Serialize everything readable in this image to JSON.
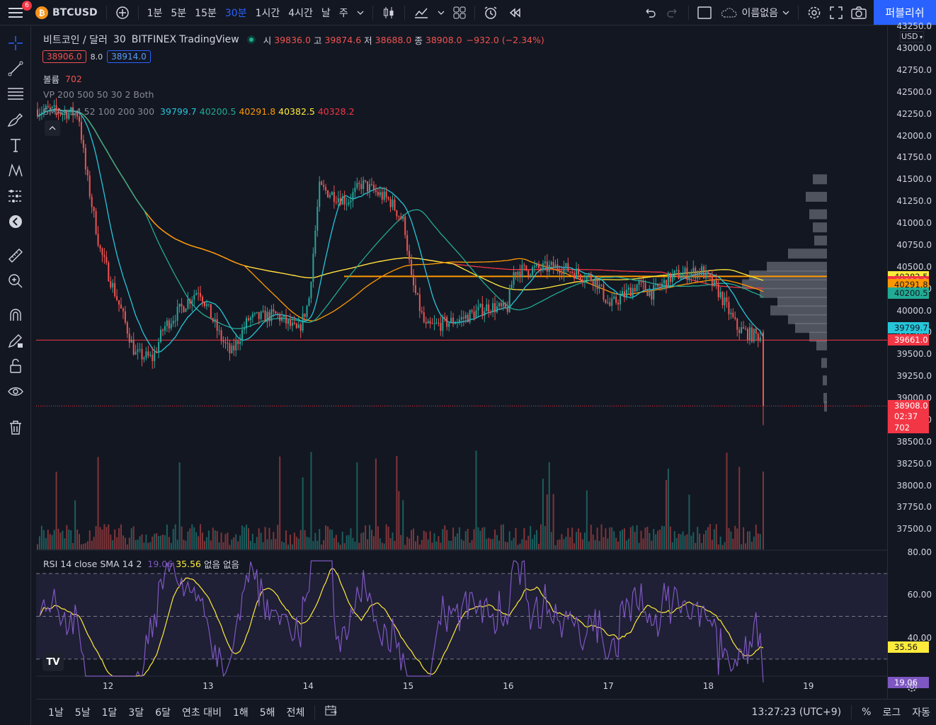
{
  "topbar": {
    "menu_badge": "6",
    "symbol": "BTCUSD",
    "intervals": [
      "1분",
      "5분",
      "15분",
      "30분",
      "1시간",
      "4시간",
      "날",
      "주"
    ],
    "active_interval": "30분",
    "layout_name": "이름없음",
    "publish": "퍼블리쉬"
  },
  "legend": {
    "title": "비트코인 / 달러",
    "interval": "30",
    "exchange": "BITFINEX",
    "source": "TradingView",
    "o_label": "시",
    "o": "39836.0",
    "h_label": "고",
    "h": "39874.6",
    "l_label": "저",
    "l": "38688.0",
    "c_label": "종",
    "c": "38908.0",
    "change": "−932.0 (−2.34%)",
    "bid": "38906.0",
    "spread": "8.0",
    "ask": "38914.0",
    "volume_label": "볼륨",
    "volume": "702",
    "vp_label": "VP 200 500 50 30 2 Both",
    "sma_label": "SMAs 14 52 100 200 300",
    "sma_values": [
      "39799.7",
      "40200.5",
      "40291.8",
      "40382.5",
      "40328.2"
    ],
    "rsi_label": "RSI 14 close SMA 14 2",
    "rsi_value": "19.06",
    "rsi_sma": "35.56",
    "rsi_none1": "없음",
    "rsi_none2": "없음"
  },
  "price_scale": {
    "currency": "USD",
    "ticks": [
      "43250.0",
      "43000.0",
      "42750.0",
      "42500.0",
      "42250.0",
      "42000.0",
      "41750.0",
      "41500.0",
      "41250.0",
      "41000.0",
      "40750.0",
      "40500.0",
      "40250.0",
      "40000.0",
      "39750.0",
      "39500.0",
      "39250.0",
      "39000.0",
      "38750.0",
      "38500.0",
      "38250.0",
      "38000.0",
      "37750.0",
      "37500.0"
    ],
    "tags": [
      {
        "value": "40382.5",
        "color": "#ffeb3b",
        "text_color": "#131722"
      },
      {
        "value": "40328.2",
        "color": "#f23645",
        "text_color": "#ffffff"
      },
      {
        "value": "40291.8",
        "color": "#ff9800",
        "text_color": "#131722"
      },
      {
        "value": "40200.5",
        "color": "#22ab94",
        "text_color": "#131722"
      },
      {
        "value": "39799.7",
        "color": "#26c6da",
        "text_color": "#131722"
      },
      {
        "value": "39661.0",
        "color": "#f23645",
        "text_color": "#ffffff"
      },
      {
        "value": "38908.0",
        "color": "#f23645",
        "text_color": "#ffffff"
      }
    ],
    "countdown": "02:37",
    "volume_tag": "702",
    "rsi_ticks": [
      "80.00",
      "60.00",
      "40.00"
    ],
    "rsi_sma_tag": "35.56",
    "rsi_tag": "19.06"
  },
  "time_axis": [
    "12",
    "13",
    "14",
    "15",
    "16",
    "17",
    "18",
    "19"
  ],
  "bottombar": {
    "ranges": [
      "1날",
      "5날",
      "1달",
      "3달",
      "6달",
      "연초 대비",
      "1해",
      "5해",
      "전체"
    ],
    "clock": "13:27:23 (UTC+9)",
    "percent": "%",
    "log": "로그",
    "auto": "자동"
  },
  "colors": {
    "up": "#26a69a",
    "down": "#ef5350",
    "sma14": "#26c6da",
    "sma52": "#22ab94",
    "sma100": "#ff9800",
    "sma200": "#ffeb3b",
    "sma300": "#f23645",
    "rsi": "#7e57c2"
  },
  "logo": "TV"
}
